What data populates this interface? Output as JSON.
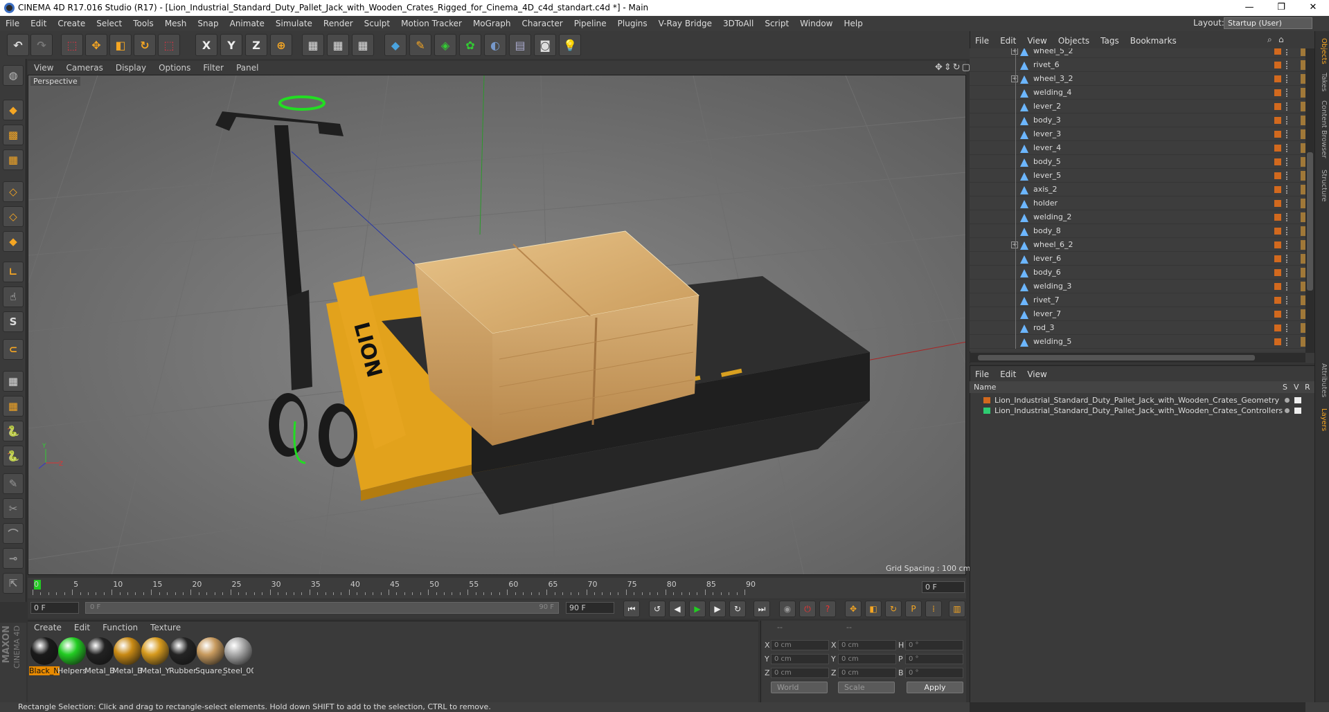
{
  "window": {
    "title": "CINEMA 4D R17.016 Studio (R17) - [Lion_Industrial_Standard_Duty_Pallet_Jack_with_Wooden_Crates_Rigged_for_Cinema_4D_c4d_standart.c4d *] - Main",
    "minimize": "—",
    "maximize": "❐",
    "close": "✕"
  },
  "menubar": [
    "File",
    "Edit",
    "Create",
    "Select",
    "Tools",
    "Mesh",
    "Snap",
    "Animate",
    "Simulate",
    "Render",
    "Sculpt",
    "Motion Tracker",
    "MoGraph",
    "Character",
    "Pipeline",
    "Plugins",
    "V-Ray Bridge",
    "3DToAll",
    "Script",
    "Window",
    "Help"
  ],
  "layout": {
    "label": "Layout:",
    "value": "Startup (User)"
  },
  "toolbar": {
    "x_axis": "X",
    "y_axis": "Y",
    "z_axis": "Z"
  },
  "viewport": {
    "menu": [
      "View",
      "Cameras",
      "Display",
      "Options",
      "Filter",
      "Panel"
    ],
    "label": "Perspective",
    "grid_spacing": "Grid Spacing : 100 cm",
    "jack_text": "LION",
    "axis_y": "Y",
    "axis_z": "Z"
  },
  "timeline": {
    "ticks": [
      "0",
      "5",
      "10",
      "15",
      "20",
      "25",
      "30",
      "35",
      "40",
      "45",
      "50",
      "55",
      "60",
      "65",
      "70",
      "75",
      "80",
      "85",
      "90"
    ],
    "current_frame": "0 F",
    "start_field": "0 F",
    "slider_start": "0 F",
    "slider_end": "90 F",
    "end_field": "90 F"
  },
  "materials": {
    "menu": [
      "Create",
      "Edit",
      "Function",
      "Texture"
    ],
    "items": [
      {
        "name": "Black_Ne",
        "color": "#1a1a1a"
      },
      {
        "name": "Helpers",
        "color": "#22cc22"
      },
      {
        "name": "Metal_B",
        "color": "#222222"
      },
      {
        "name": "Metal_B",
        "color": "#c98a14"
      },
      {
        "name": "Metal_Y",
        "color": "#d69a1e"
      },
      {
        "name": "Rubber",
        "color": "#242424"
      },
      {
        "name": "Square_",
        "color": "#c79a5e"
      },
      {
        "name": "Steel_00",
        "color": "#aaaaaa"
      }
    ]
  },
  "coords": {
    "dash1": "--",
    "dash2": "--",
    "x": "X",
    "y": "Y",
    "z": "Z",
    "px": "0 cm",
    "py": "0 cm",
    "pz": "0 cm",
    "sx_label": "X",
    "sy_label": "Y",
    "sz_label": "Z",
    "sx": "0 cm",
    "sy": "0 cm",
    "sz": "0 cm",
    "h": "H",
    "p": "P",
    "b": "B",
    "rh": "0 °",
    "rp": "0 °",
    "rb": "0 °",
    "world": "World",
    "scale": "Scale",
    "apply": "Apply"
  },
  "objects": {
    "menu": [
      "File",
      "Edit",
      "View",
      "Objects",
      "Tags",
      "Bookmarks"
    ],
    "items": [
      {
        "name": "wheel_5_2",
        "expand": true
      },
      {
        "name": "rivet_6",
        "expand": false
      },
      {
        "name": "wheel_3_2",
        "expand": true
      },
      {
        "name": "welding_4",
        "expand": false
      },
      {
        "name": "lever_2",
        "expand": false
      },
      {
        "name": "body_3",
        "expand": false
      },
      {
        "name": "lever_3",
        "expand": false
      },
      {
        "name": "lever_4",
        "expand": false
      },
      {
        "name": "body_5",
        "expand": false
      },
      {
        "name": "lever_5",
        "expand": false
      },
      {
        "name": "axis_2",
        "expand": false
      },
      {
        "name": "holder",
        "expand": false
      },
      {
        "name": "welding_2",
        "expand": false
      },
      {
        "name": "body_8",
        "expand": false
      },
      {
        "name": "wheel_6_2",
        "expand": true
      },
      {
        "name": "lever_6",
        "expand": false
      },
      {
        "name": "body_6",
        "expand": false
      },
      {
        "name": "welding_3",
        "expand": false
      },
      {
        "name": "rivet_7",
        "expand": false
      },
      {
        "name": "lever_7",
        "expand": false
      },
      {
        "name": "rod_3",
        "expand": false
      },
      {
        "name": "welding_5",
        "expand": false
      }
    ]
  },
  "layers": {
    "menu": [
      "File",
      "Edit",
      "View"
    ],
    "head": {
      "name": "Name",
      "s": "S",
      "v": "V",
      "r": "R"
    },
    "items": [
      {
        "name": "Lion_Industrial_Standard_Duty_Pallet_Jack_with_Wooden_Crates_Geometry",
        "color": "#d2691e"
      },
      {
        "name": "Lion_Industrial_Standard_Duty_Pallet_Jack_with_Wooden_Crates_Controllers",
        "color": "#2ecc71"
      }
    ]
  },
  "side_tabs": [
    "Objects",
    "Takes",
    "Content Browser",
    "Structure",
    "Attributes",
    "Layers"
  ],
  "brand": {
    "line1": "MAXON",
    "line2": "CINEMA 4D"
  },
  "status": "Rectangle Selection: Click and drag to rectangle-select elements. Hold down SHIFT to add to the selection, CTRL to remove."
}
